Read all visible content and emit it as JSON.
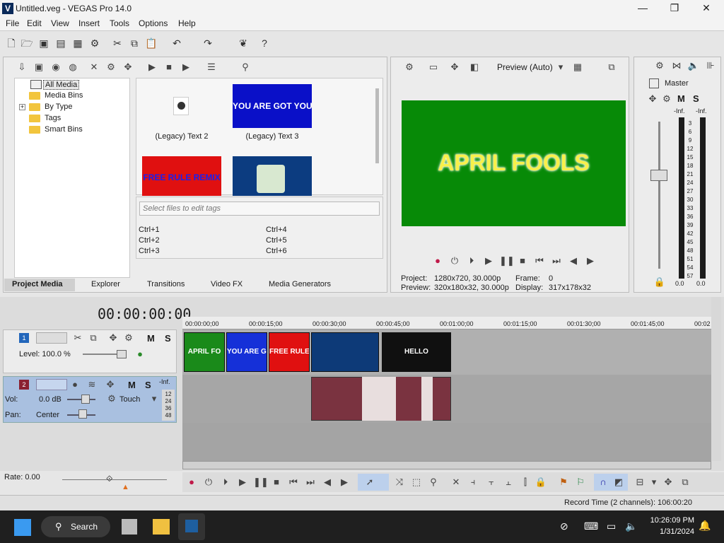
{
  "window": {
    "title": "Untitled.veg - VEGAS Pro 14.0",
    "minimize": "—",
    "maximize": "❐",
    "close": "✕"
  },
  "menu": [
    "File",
    "Edit",
    "View",
    "Insert",
    "Tools",
    "Options",
    "Help"
  ],
  "project_media": {
    "tree": [
      "All Media",
      "Media Bins",
      "By Type",
      "Tags",
      "Smart Bins"
    ],
    "expander": "+",
    "thumbs": [
      {
        "label": "(Legacy) Text 2"
      },
      {
        "label": "(Legacy) Text 3",
        "text": "YOU ARE GOT YOU"
      },
      {
        "text": "FREE RULE REMIX"
      },
      {
        "text": ""
      }
    ],
    "tags_placeholder": "Select files to edit tags",
    "shortcuts": [
      "Ctrl+1",
      "Ctrl+4",
      "Ctrl+2",
      "Ctrl+5",
      "Ctrl+3",
      "Ctrl+6"
    ]
  },
  "tabs": [
    "Project Media",
    "Explorer",
    "Transitions",
    "Video FX",
    "Media Generators"
  ],
  "preview": {
    "mode": "Preview (Auto)",
    "overlay_text": "APRIL FOOLS",
    "project_label": "Project:",
    "project_value": "1280x720, 30.000p",
    "frame_label": "Frame:",
    "frame_value": "0",
    "preview_label": "Preview:",
    "preview_value": "320x180x32, 30.000p",
    "display_label": "Display:",
    "display_value": "317x178x32"
  },
  "master": {
    "label": "Master",
    "m": "M",
    "s": "S",
    "inf_left": "-Inf.",
    "inf_right": "-Inf.",
    "scale": [
      "3",
      "6",
      "9",
      "12",
      "15",
      "18",
      "21",
      "24",
      "27",
      "30",
      "33",
      "36",
      "39",
      "42",
      "45",
      "48",
      "51",
      "54",
      "57"
    ],
    "bottom_left": "0.0",
    "bottom_right": "0.0"
  },
  "timeline": {
    "timecode": "00:00:00:00",
    "ruler": [
      "00:00:00;00",
      "00:00:15;00",
      "00:00:30;00",
      "00:00:45;00",
      "00:01:00;00",
      "00:01:15;00",
      "00:01:30;00",
      "00:01:45;00",
      "00:02"
    ],
    "track1": {
      "number": "1",
      "level": "Level: 100.0 %",
      "m": "M",
      "s": "S"
    },
    "track2": {
      "number": "2",
      "vol_label": "Vol:",
      "vol_value": "0.0 dB",
      "pan_label": "Pan:",
      "pan_value": "Center",
      "mode": "Touch",
      "m": "M",
      "s": "S",
      "inf": "-Inf.",
      "scale": [
        "12",
        "24",
        "36",
        "48"
      ]
    },
    "clips": [
      {
        "text": "APRIL FO",
        "color": "#1a8a1a"
      },
      {
        "text": "YOU ARE GOT",
        "color": "#1530d8"
      },
      {
        "text": "FREE RULE",
        "color": "#e01010"
      },
      {
        "text": "",
        "color": "#0d3a78"
      },
      {
        "text": "HELLO",
        "color": "#101010"
      }
    ],
    "rate": "Rate: 0.00"
  },
  "status": {
    "record_time": "Record Time (2 channels): 106:00:20"
  },
  "taskbar": {
    "search": "Search",
    "time": "10:26:09 PM",
    "date": "1/31/2024"
  }
}
